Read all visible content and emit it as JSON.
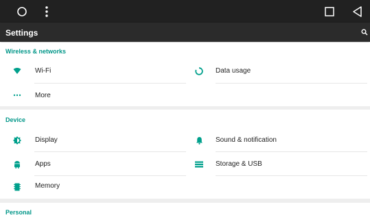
{
  "app_bar": {
    "title": "Settings",
    "search_icon": "search-icon"
  },
  "nav_bar": {
    "home_icon": "home-circle-icon",
    "menu_icon": "overflow-menu-icon",
    "recents_icon": "recents-square-icon",
    "back_icon": "back-triangle-icon"
  },
  "sections": {
    "wireless": {
      "title": "Wireless & networks",
      "items": [
        {
          "label": "Wi-Fi",
          "icon": "wifi-icon"
        },
        {
          "label": "Data usage",
          "icon": "data-usage-icon"
        },
        {
          "label": "More",
          "icon": "more-dots-icon"
        }
      ]
    },
    "device": {
      "title": "Device",
      "items": [
        {
          "label": "Display",
          "icon": "display-brightness-icon"
        },
        {
          "label": "Sound & notification",
          "icon": "bell-icon"
        },
        {
          "label": "Apps",
          "icon": "android-icon"
        },
        {
          "label": "Storage & USB",
          "icon": "storage-icon"
        },
        {
          "label": "Memory",
          "icon": "memory-chip-icon"
        }
      ]
    },
    "personal": {
      "title": "Personal"
    }
  },
  "colors": {
    "accent": "#009688",
    "icon": "#00a08c",
    "nav_bg": "#212121",
    "appbar_bg": "#2b2b2b"
  }
}
